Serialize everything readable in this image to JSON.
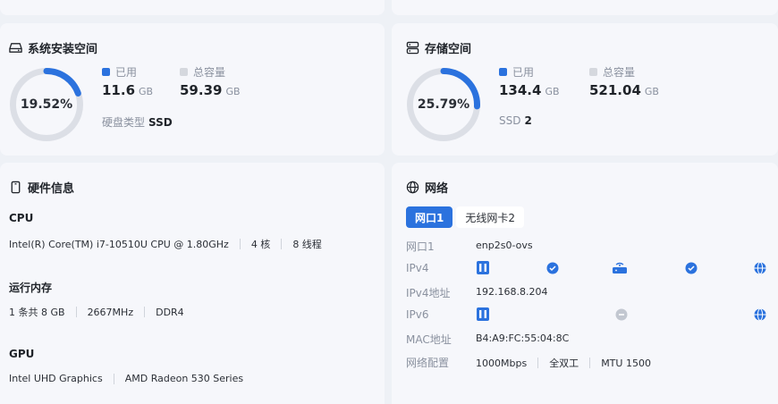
{
  "system_disk": {
    "title": "系统安装空间",
    "percent_label": "19.52%",
    "percent": 19.52,
    "used_label": "已用",
    "used_value": "11.6",
    "used_unit": "GB",
    "total_label": "总容量",
    "total_value": "59.39",
    "total_unit": "GB",
    "disk_type_label": "硬盘类型",
    "disk_type_value": "SSD"
  },
  "storage": {
    "title": "存储空间",
    "percent_label": "25.79%",
    "percent": 25.79,
    "used_label": "已用",
    "used_value": "134.4",
    "used_unit": "GB",
    "total_label": "总容量",
    "total_value": "521.04",
    "total_unit": "GB",
    "ssd_label": "SSD",
    "ssd_count": "2"
  },
  "hardware": {
    "title": "硬件信息",
    "cpu_head": "CPU",
    "cpu_model": "Intel(R) Core(TM) i7-10510U CPU @ 1.80GHz",
    "cpu_cores": "4 核",
    "cpu_threads": "8 线程",
    "mem_head": "运行内存",
    "mem_count": "1 条共 8 GB",
    "mem_freq": "2667MHz",
    "mem_type": "DDR4",
    "gpu_head": "GPU",
    "gpu_1": "Intel UHD Graphics",
    "gpu_2": "AMD Radeon 530 Series"
  },
  "network": {
    "title": "网络",
    "tabs": [
      "网口1",
      "无线网卡2"
    ],
    "port_label": "网口1",
    "port_value": "enp2s0-ovs",
    "ipv4_label": "IPv4",
    "ipv4_addr_label": "IPv4地址",
    "ipv4_addr_value": "192.168.8.204",
    "ipv6_label": "IPv6",
    "mac_label": "MAC地址",
    "mac_value": "B4:A9:FC:55:04:8C",
    "config_label": "网络配置",
    "speed": "1000Mbps",
    "duplex": "全双工",
    "mtu": "MTU 1500"
  },
  "colors": {
    "accent": "#2b72de",
    "ring_track": "#dcdfe6",
    "legend_total": "#d5d8de",
    "card_bg": "#f6f7fb"
  }
}
